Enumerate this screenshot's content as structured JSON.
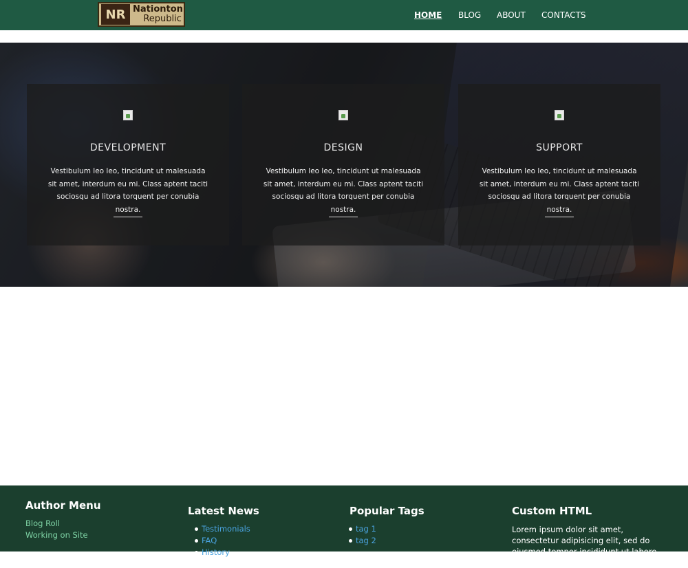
{
  "header": {
    "logo_mark": "NR",
    "logo_line1": "Nationton",
    "logo_line2": "Republic",
    "nav": [
      {
        "label": "HOME",
        "active": true
      },
      {
        "label": "BLOG",
        "active": false
      },
      {
        "label": "ABOUT",
        "active": false
      },
      {
        "label": "CONTACTS",
        "active": false
      }
    ]
  },
  "hero": {
    "cards": [
      {
        "title": "DEVELOPMENT",
        "text": "Vestibulum leo leo, tincidunt ut malesuada sit amet, interdum eu mi. Class aptent taciti sociosqu ad litora torquent per conubia nostra.",
        "icon": "broken-image-icon"
      },
      {
        "title": "DESIGN",
        "text": "Vestibulum leo leo, tincidunt ut malesuada sit amet, interdum eu mi. Class aptent taciti sociosqu ad litora torquent per conubia nostra.",
        "icon": "broken-image-icon"
      },
      {
        "title": "SUPPORT",
        "text": "Vestibulum leo leo, tincidunt ut malesuada sit amet, interdum eu mi. Class aptent taciti sociosqu ad litora torquent per conubia nostra.",
        "icon": "broken-image-icon"
      }
    ]
  },
  "footer": {
    "author_menu": {
      "title": "Author Menu",
      "links": [
        "Blog Roll",
        "Working on Site"
      ]
    },
    "latest_news": {
      "title": "Latest News",
      "items": [
        "Testimonials",
        "FAQ",
        "History"
      ]
    },
    "popular_tags": {
      "title": "Popular Tags",
      "items": [
        "tag 1",
        "tag 2"
      ]
    },
    "custom_html": {
      "title": "Custom HTML",
      "text": "Lorem ipsum dolor sit amet, consectetur adipisicing elit, sed do eiusmod tempor incididunt ut labore et dolore magna"
    }
  },
  "colors": {
    "header_bg": "#1f5a43",
    "footer_bg": "#1b3f2e",
    "footer_link": "#7fd4a6",
    "list_link": "#4aa3e0"
  }
}
